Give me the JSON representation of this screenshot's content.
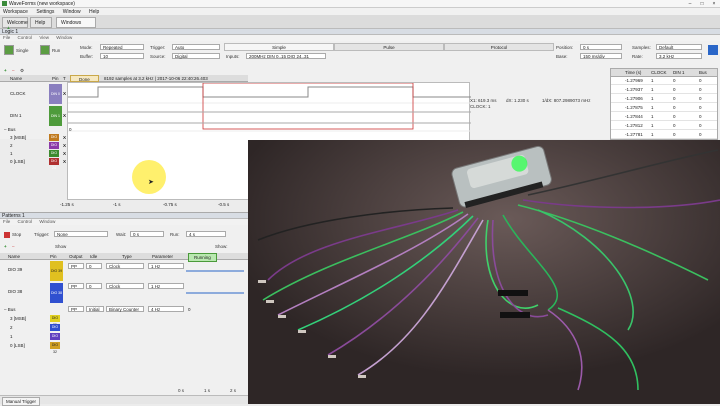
{
  "app": {
    "title": "WaveForms (new workspace)"
  },
  "menu": [
    "Workspace",
    "Settings",
    "Window",
    "Help"
  ],
  "tabs": [
    "Welcome",
    "Help",
    "Windows"
  ],
  "logic": {
    "title": "Logic 1",
    "submenu": [
      "File",
      "Control",
      "View",
      "Window"
    ],
    "single": "Single",
    "run": "Run",
    "mode_label": "Mode:",
    "mode_value": "Repeated",
    "buffer_label": "Buffer:",
    "buffer_value": "10",
    "trigger_label": "Trigger:",
    "trigger_value": "Auto",
    "source_label": "Source:",
    "source_value": "Digital",
    "segments": [
      "Simple",
      "Pulse",
      "Protocol"
    ],
    "inputs_label": "Inputs:",
    "inputs_value": "200MHz DIN 0..15 DIO 24..31",
    "position_label": "Position:",
    "position_value": "0 s",
    "base_label": "Base:",
    "base_value": "150 ms/div",
    "samples_label": "Samples:",
    "samples_value": "Default",
    "rate_label": "Rate:",
    "rate_value": "3.2 kHz",
    "col_name": "Name",
    "col_pin": "Pin",
    "col_t": "T",
    "done": "Done",
    "info": "8192 samples at 3.2 kHz | 2017-10-06 22:40:26.403",
    "channels": [
      {
        "name": "CLOCK",
        "pin": "DIN 0",
        "color": "#8a7fbf"
      },
      {
        "name": "DIN 1",
        "pin": "DIN 1",
        "color": "#4e9b3b"
      }
    ],
    "bus": "Bus",
    "bus_value": "0",
    "bus_rows": [
      {
        "name": "3 [MSB]",
        "pin": "DIO 27",
        "color": "#c07a1e"
      },
      {
        "name": "2",
        "pin": "DIO 26",
        "color": "#8b3aa8"
      },
      {
        "name": "1",
        "pin": "DIO 25",
        "color": "#3c8a2e"
      },
      {
        "name": "0 [LSB]",
        "pin": "DIO 24",
        "color": "#b03030"
      }
    ],
    "cursor_x1": "X1: 619.3 ms",
    "cursor_clock": "CLOCK: 1",
    "cursor_dx": "dX: 1.230 s",
    "cursor_freq": "1/dX: 807.2989073 mHz",
    "axis": [
      "-1.25 s",
      "-1 s",
      "-0.75 s",
      "-0.5 s"
    ]
  },
  "table": {
    "headers": [
      "Time (s)",
      "CLOCK",
      "DIN 1",
      "Bus"
    ],
    "rows": [
      [
        "-1.27969",
        "1",
        "0",
        "0"
      ],
      [
        "-1.27937",
        "1",
        "0",
        "0"
      ],
      [
        "-1.27906",
        "1",
        "0",
        "0"
      ],
      [
        "-1.27875",
        "1",
        "0",
        "0"
      ],
      [
        "-1.27844",
        "1",
        "0",
        "0"
      ],
      [
        "-1.27812",
        "1",
        "0",
        "0"
      ],
      [
        "-1.27781",
        "1",
        "0",
        "0"
      ]
    ]
  },
  "patterns": {
    "title": "Patterns 1",
    "submenu": [
      "File",
      "Control",
      "Window"
    ],
    "stop": "Stop",
    "trigger_label": "Trigger:",
    "trigger_value": "None",
    "wait_label": "Wait:",
    "wait_value": "0 s",
    "run_label": "Run:",
    "run_value": "4 s",
    "repeat_label": "Repeat:",
    "show": "Show",
    "allow": "Allow",
    "show_label": "Show:",
    "headers": [
      "Name",
      "Pin",
      "Output",
      "Idle",
      "Type",
      "Parameter",
      "Running"
    ],
    "rows": [
      {
        "name": "DIO 39",
        "pin": "DIO 39",
        "output": "PP",
        "idle": "0",
        "type": "Clock",
        "param": "1 Hz",
        "color": "#e0c020"
      },
      {
        "name": "DIO 38",
        "pin": "DIO 38",
        "output": "PP",
        "idle": "0",
        "type": "Clock",
        "param": "1 Hz",
        "color": "#3050d0"
      }
    ],
    "bus": "Bus",
    "bus_output": "PP",
    "bus_idle": "Initial",
    "bus_type": "Binary Counter",
    "bus_param": "4 Hz",
    "bus_value": "0",
    "bus_rows": [
      {
        "name": "3 [MSB]",
        "pin": "DIO 35",
        "color": "#e0d020"
      },
      {
        "name": "2",
        "pin": "DIO 34",
        "color": "#3050d0"
      },
      {
        "name": "1",
        "pin": "DIO 33",
        "color": "#6040c0"
      },
      {
        "name": "0 [LSB]",
        "pin": "DIO 32",
        "color": "#d0a020"
      }
    ],
    "axis": [
      "0 s",
      "1 s",
      "2 s"
    ]
  },
  "status": {
    "manual_trigger": "Manual Trigger"
  },
  "colors": {
    "accent_green": "#5ab44a",
    "waveform": "#888888",
    "cursor": "#cc3333"
  }
}
